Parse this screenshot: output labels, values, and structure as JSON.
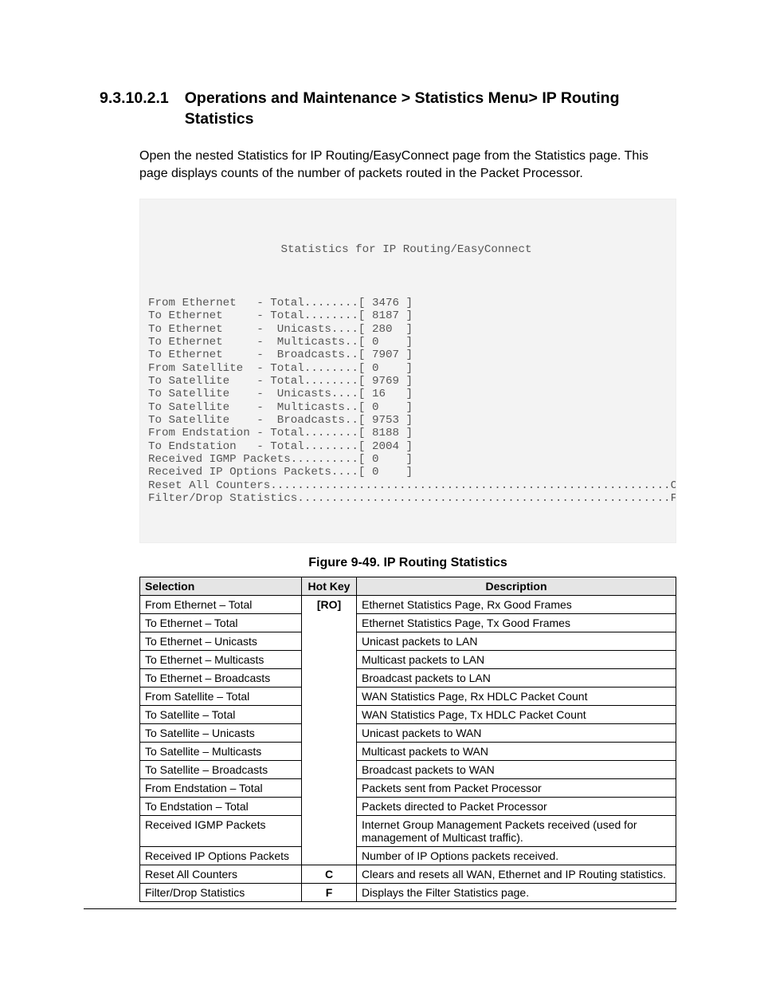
{
  "heading": {
    "number": "9.3.10.2.1",
    "title": "Operations and Maintenance > Statistics Menu> IP Routing Statistics"
  },
  "body": "Open the nested Statistics for IP Routing/EasyConnect page from the Statistics page. This page displays counts of the number of packets routed in the Packet Processor.",
  "terminal": {
    "title": "Statistics for IP Routing/EasyConnect",
    "rows": [
      {
        "label": "From Ethernet   - Total........",
        "value": "3476"
      },
      {
        "label": "To Ethernet     - Total........",
        "value": "8187"
      },
      {
        "label": "To Ethernet     -  Unicasts....",
        "value": "280 "
      },
      {
        "label": "To Ethernet     -  Multicasts..",
        "value": "0   "
      },
      {
        "label": "To Ethernet     -  Broadcasts..",
        "value": "7907"
      },
      {
        "label": "From Satellite  - Total........",
        "value": "0   "
      },
      {
        "label": "To Satellite    - Total........",
        "value": "9769"
      },
      {
        "label": "To Satellite    -  Unicasts....",
        "value": "16  "
      },
      {
        "label": "To Satellite    -  Multicasts..",
        "value": "0   "
      },
      {
        "label": "To Satellite    -  Broadcasts..",
        "value": "9753"
      },
      {
        "label": "From Endstation - Total........",
        "value": "8188"
      },
      {
        "label": "To Endstation   - Total........",
        "value": "2004"
      },
      {
        "label": "Received IGMP Packets..........",
        "value": "0   "
      },
      {
        "label": "Received IP Options Packets....",
        "value": "0   "
      }
    ],
    "actions": [
      {
        "label": "Reset All Counters",
        "key": "C"
      },
      {
        "label": "Filter/Drop Statistics",
        "key": "F"
      }
    ]
  },
  "figure_caption": "Figure 9-49. IP Routing Statistics",
  "table": {
    "headers": {
      "selection": "Selection",
      "hotkey": "Hot Key",
      "description": "Description"
    },
    "ro_label": "[RO]",
    "rows": [
      {
        "sel": "From Ethernet – Total",
        "hk": "[RO]",
        "desc": "Ethernet Statistics Page, Rx Good Frames",
        "cls": "ro-span"
      },
      {
        "sel": "To Ethernet – Total",
        "hk": "",
        "desc": "Ethernet Statistics Page, Tx Good Frames",
        "cls": "ro-mid"
      },
      {
        "sel": "To Ethernet – Unicasts",
        "hk": "",
        "desc": "Unicast packets to LAN",
        "cls": "ro-mid"
      },
      {
        "sel": "To Ethernet – Multicasts",
        "hk": "",
        "desc": "Multicast packets to LAN",
        "cls": "ro-mid"
      },
      {
        "sel": "To Ethernet – Broadcasts",
        "hk": "",
        "desc": "Broadcast packets to LAN",
        "cls": "ro-mid"
      },
      {
        "sel": "From Satellite – Total",
        "hk": "",
        "desc": "WAN Statistics Page, Rx HDLC Packet Count",
        "cls": "ro-mid"
      },
      {
        "sel": "To Satellite – Total",
        "hk": "",
        "desc": "WAN Statistics Page, Tx HDLC Packet Count",
        "cls": "ro-mid"
      },
      {
        "sel": "To Satellite – Unicasts",
        "hk": "",
        "desc": "Unicast packets to WAN",
        "cls": "ro-mid"
      },
      {
        "sel": "To Satellite – Multicasts",
        "hk": "",
        "desc": "Multicast packets to WAN",
        "cls": "ro-mid"
      },
      {
        "sel": "To Satellite – Broadcasts",
        "hk": "",
        "desc": "Broadcast packets to WAN",
        "cls": "ro-mid"
      },
      {
        "sel": "From Endstation – Total",
        "hk": "",
        "desc": "Packets sent from Packet Processor",
        "cls": "ro-mid"
      },
      {
        "sel": "To Endstation – Total",
        "hk": "",
        "desc": "Packets directed to Packet Processor",
        "cls": "ro-mid"
      },
      {
        "sel": "Received IGMP Packets",
        "hk": "",
        "desc": "Internet Group Management Packets received (used for management of Multicast traffic).",
        "cls": "ro-mid"
      },
      {
        "sel": "Received IP Options Packets",
        "hk": "",
        "desc": "Number of IP Options packets received.",
        "cls": "ro-end"
      },
      {
        "sel": "Reset All Counters",
        "hk": "C",
        "desc": "Clears and resets all WAN, Ethernet and IP Routing statistics.",
        "cls": ""
      },
      {
        "sel": "Filter/Drop Statistics",
        "hk": "F",
        "desc": "Displays the Filter Statistics page.",
        "cls": ""
      }
    ]
  }
}
